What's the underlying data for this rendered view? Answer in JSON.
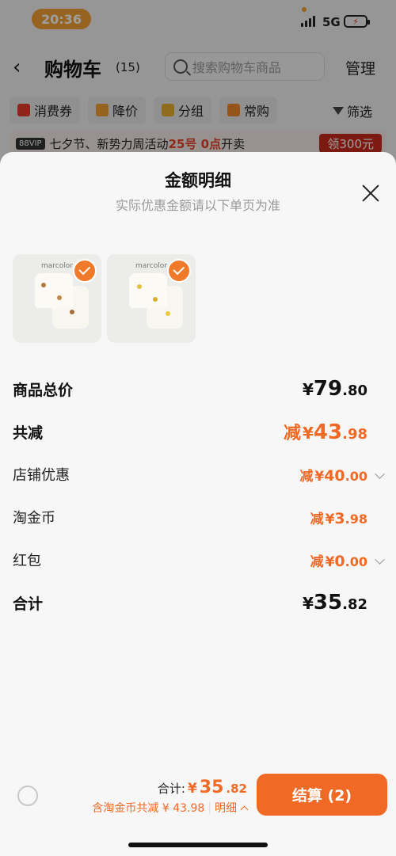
{
  "status_bar": {
    "time": "20:36",
    "network": "5G",
    "battery_icon": "battery-charging-icon"
  },
  "header": {
    "title": "购物车",
    "count": "(15)",
    "search_placeholder": "搜索购物车商品",
    "manage_label": "管理"
  },
  "filters": {
    "chips": [
      {
        "label": "消费券",
        "icon": "coupon-icon",
        "color": "#e53b2a"
      },
      {
        "label": "降价",
        "icon": "price-down-icon",
        "color": "#f0a030"
      },
      {
        "label": "分组",
        "icon": "folder-icon",
        "color": "#e8b030"
      },
      {
        "label": "常购",
        "icon": "cart-icon",
        "color": "#f08a2a"
      }
    ],
    "filter_label": "筛选"
  },
  "promo": {
    "badge": "88VIP",
    "text_prefix": "七夕节、新势力周活动",
    "highlight": "25号 0点",
    "text_suffix": "开卖",
    "coupon_button": "领300元"
  },
  "sheet": {
    "title": "金额明细",
    "subtitle": "实际优惠金额请以下单页为准",
    "thumbnails": [
      {
        "brand": "marcolor",
        "selected": true
      },
      {
        "brand": "marcolor",
        "selected": true
      }
    ],
    "rows": [
      {
        "label": "商品总价",
        "prefix": "",
        "currency": "¥",
        "int": "79",
        "dec": ".80"
      },
      {
        "label": "共减",
        "prefix": "减",
        "currency": "¥",
        "int": "43",
        "dec": ".98"
      },
      {
        "label": "店铺优惠",
        "prefix": "减",
        "currency": "¥",
        "int": "40",
        "dec": ".00"
      },
      {
        "label": "淘金币",
        "prefix": "减",
        "currency": "¥",
        "int": "3",
        "dec": ".98"
      },
      {
        "label": "红包",
        "prefix": "减",
        "currency": "¥",
        "int": "0",
        "dec": ".00"
      },
      {
        "label": "合计",
        "prefix": "",
        "currency": "¥",
        "int": "35",
        "dec": ".82"
      }
    ]
  },
  "bottom_bar": {
    "total_label": "合计:",
    "total_currency": "¥",
    "total_int": "35",
    "total_dec": ".82",
    "discount_note": "含淘金币共减 ¥ 43.98",
    "detail_label": "明细",
    "checkout_label": "结算 (2)"
  },
  "colors": {
    "accent": "#f06a25",
    "promo_red": "#c92a1e"
  }
}
